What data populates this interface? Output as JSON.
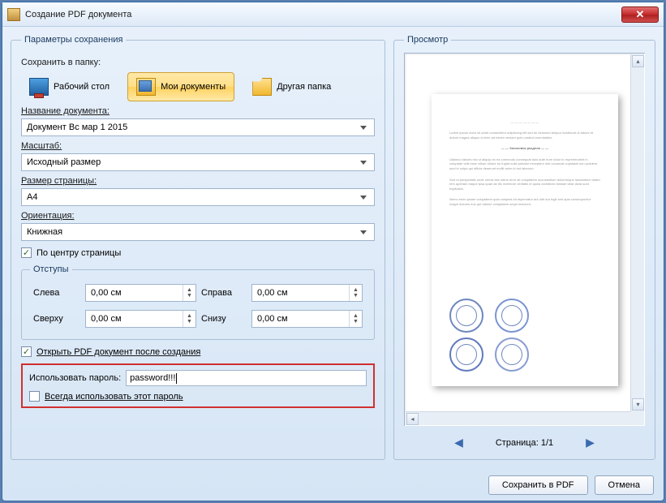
{
  "window": {
    "title": "Создание PDF документа"
  },
  "params_group": "Параметры сохранения",
  "preview_group": "Просмотр",
  "save_folder_label": "Сохранить в папку:",
  "folders": {
    "desktop": "Рабочий стол",
    "documents": "Мои документы",
    "other": "Другая папка"
  },
  "doc_name_label": "Название документа:",
  "doc_name_value": "Документ Вс мар 1 2015",
  "scale_label": "Масштаб:",
  "scale_value": "Исходный размер",
  "pagesize_label": "Размер страницы:",
  "pagesize_value": "A4",
  "orientation_label": "Ориентация:",
  "orientation_value": "Книжная",
  "center_label": "По центру страницы",
  "margins_group": "Отступы",
  "margins": {
    "left_label": "Слева",
    "left_value": "0,00 см",
    "right_label": "Справа",
    "right_value": "0,00 см",
    "top_label": "Сверху",
    "top_value": "0,00 см",
    "bottom_label": "Снизу",
    "bottom_value": "0,00 см"
  },
  "open_after_label": "Открыть PDF документ после создания",
  "password": {
    "label": "Использовать пароль:",
    "value": "password!!!",
    "always_label": "Всегда использовать этот пароль"
  },
  "pager": {
    "label": "Страница: 1/1"
  },
  "buttons": {
    "save": "Сохранить в PDF",
    "cancel": "Отмена"
  }
}
